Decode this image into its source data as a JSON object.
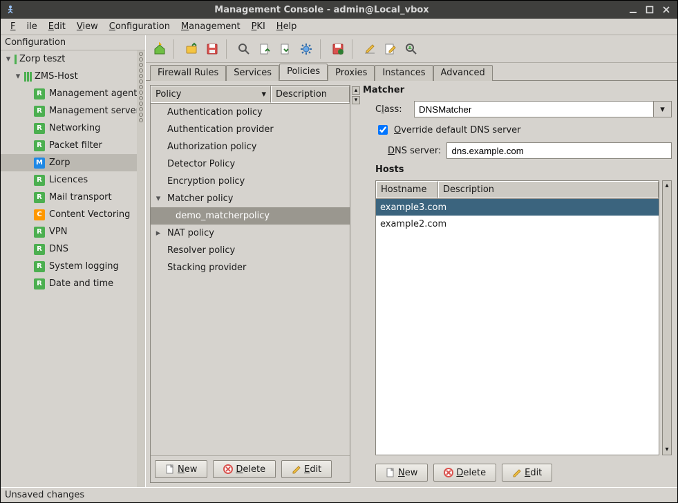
{
  "window": {
    "title": "Management Console - admin@Local_vbox"
  },
  "menu": {
    "file": "File",
    "edit": "Edit",
    "view": "View",
    "configuration": "Configuration",
    "management": "Management",
    "pki": "PKI",
    "help": "Help"
  },
  "sidebar": {
    "heading": "Configuration",
    "root": "Zorp teszt",
    "host": "ZMS-Host",
    "items": [
      {
        "icon": "R",
        "label": "Management agents"
      },
      {
        "icon": "R",
        "label": "Management server"
      },
      {
        "icon": "R",
        "label": "Networking"
      },
      {
        "icon": "R",
        "label": "Packet filter"
      },
      {
        "icon": "M",
        "label": "Zorp",
        "selected": true
      },
      {
        "icon": "R",
        "label": "Licences"
      },
      {
        "icon": "R",
        "label": "Mail transport"
      },
      {
        "icon": "C",
        "label": "Content Vectoring"
      },
      {
        "icon": "R",
        "label": "VPN"
      },
      {
        "icon": "R",
        "label": "DNS"
      },
      {
        "icon": "R",
        "label": "System logging"
      },
      {
        "icon": "R",
        "label": "Date and time"
      }
    ]
  },
  "tabs": {
    "firewall": "Firewall Rules",
    "services": "Services",
    "policies": "Policies",
    "proxies": "Proxies",
    "instances": "Instances",
    "advanced": "Advanced"
  },
  "policy_grid": {
    "col_policy": "Policy",
    "col_desc": "Description",
    "rows": [
      {
        "label": "Authentication policy"
      },
      {
        "label": "Authentication provider"
      },
      {
        "label": "Authorization policy"
      },
      {
        "label": "Detector Policy"
      },
      {
        "label": "Encryption policy"
      },
      {
        "label": "Matcher policy",
        "expanded": true,
        "children": [
          {
            "label": "demo_matcherpolicy",
            "selected": true
          }
        ]
      },
      {
        "label": "NAT policy",
        "collapsed": true
      },
      {
        "label": "Resolver policy"
      },
      {
        "label": "Stacking provider"
      }
    ]
  },
  "buttons": {
    "new": "New",
    "delete": "Delete",
    "edit": "Edit"
  },
  "matcher": {
    "heading": "Matcher",
    "class_label": "Class:",
    "class_value": "DNSMatcher",
    "override_label": "Override default DNS server",
    "override_checked": true,
    "dns_label": "DNS server:",
    "dns_value": "dns.example.com",
    "hosts_heading": "Hosts",
    "hosts_columns": {
      "hostname": "Hostname",
      "description": "Description"
    },
    "hosts": [
      {
        "hostname": "example3.com",
        "selected": true
      },
      {
        "hostname": "example2.com"
      }
    ]
  },
  "status": "Unsaved changes"
}
